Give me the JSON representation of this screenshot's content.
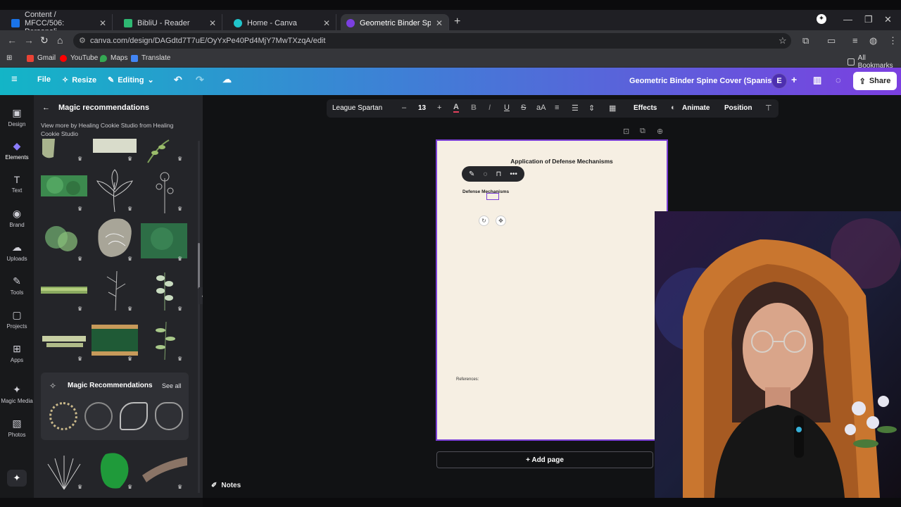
{
  "browser": {
    "tabs": [
      {
        "title": "Content / MFCC/506: Personali",
        "color": "#1a73e8"
      },
      {
        "title": "BibliU - Reader",
        "color": "#2eb872"
      },
      {
        "title": "Home - Canva",
        "color": "#20c4cb"
      },
      {
        "title": "Geometric Binder Spine Cover (",
        "color": "#7b3fe0"
      }
    ],
    "url": "canva.com/design/DAGdtd7T7uE/OyYxPe40Pd4MjY7MwTXzqA/edit",
    "bookmarks": [
      "Gmail",
      "YouTube",
      "Maps",
      "Translate"
    ],
    "all_bookmarks": "All Bookmarks"
  },
  "canva_header": {
    "file": "File",
    "resize": "Resize",
    "editing": "Editing",
    "design_title": "Geometric Binder Spine Cover (Spanish)",
    "avatar_initial": "E",
    "share": "Share"
  },
  "rail": [
    {
      "label": "Design",
      "icon": "design-icon",
      "glyph": "▣"
    },
    {
      "label": "Elements",
      "icon": "elements-icon",
      "glyph": "◆"
    },
    {
      "label": "Text",
      "icon": "text-icon",
      "glyph": "T"
    },
    {
      "label": "Brand",
      "icon": "brand-icon",
      "glyph": "◉"
    },
    {
      "label": "Uploads",
      "icon": "uploads-icon",
      "glyph": "☁"
    },
    {
      "label": "Tools",
      "icon": "tools-icon",
      "glyph": "✎"
    },
    {
      "label": "Projects",
      "icon": "projects-icon",
      "glyph": "▢"
    },
    {
      "label": "Apps",
      "icon": "apps-icon",
      "glyph": "⊞"
    },
    {
      "label": "Magic Media",
      "icon": "magic-media-icon",
      "glyph": "✦"
    },
    {
      "label": "Photos",
      "icon": "photos-icon",
      "glyph": "▧"
    }
  ],
  "panel": {
    "title": "Magic recommendations",
    "subtitle": "View more by Healing Cookie Studio from Healing Cookie Studio",
    "magic_title": "Magic Recommendations",
    "see_all": "See all"
  },
  "toolbar": {
    "font": "League Spartan",
    "size": "13",
    "effects": "Effects",
    "animate": "Animate",
    "position": "Position"
  },
  "page": {
    "title": "Application of Defense Mechanisms",
    "subheading": "Defense Mechanisms",
    "references": "References:"
  },
  "add_page": "+ Add page",
  "notes": "Notes"
}
